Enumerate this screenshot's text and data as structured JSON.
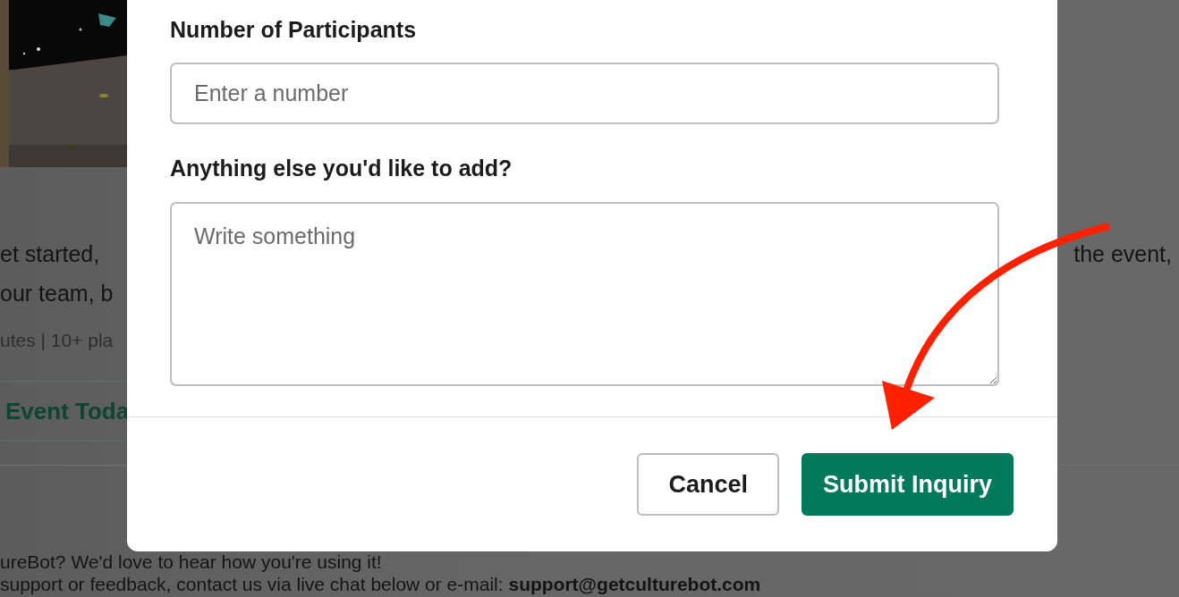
{
  "background": {
    "description_lines": [
      "et started,",
      "our team, b"
    ],
    "description_right": "the event,",
    "meta": "utes | 10+ pla",
    "event_link": "Event Toda",
    "footer_lines": [
      {
        "text": "ureBot? We'd love to hear how you're using it!"
      },
      {
        "text": "support or feedback, contact us via live chat below or e-mail: **support@getculturebot.com**"
      }
    ]
  },
  "modal": {
    "fields": [
      {
        "kind": "input",
        "label": "Number of Participants",
        "placeholder": "Enter a number"
      },
      {
        "kind": "textarea",
        "label": "Anything else you'd like to add?",
        "placeholder": "Write something"
      }
    ],
    "buttons": [
      {
        "kind": "secondary",
        "label": "Cancel"
      },
      {
        "kind": "primary",
        "label": "Submit Inquiry"
      }
    ]
  }
}
